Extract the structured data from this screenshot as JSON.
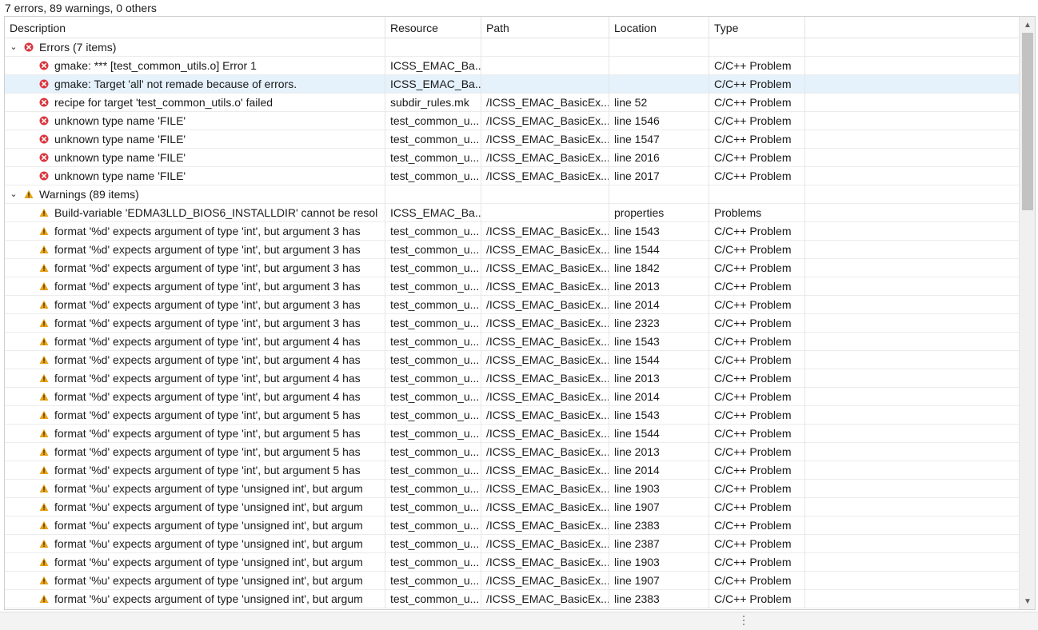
{
  "summary": "7 errors, 89 warnings, 0 others",
  "columns": {
    "description": "Description",
    "resource": "Resource",
    "path": "Path",
    "location": "Location",
    "type": "Type"
  },
  "icons": {
    "error": "error-icon",
    "warning": "warning-icon",
    "expanded": "chevron-down-icon",
    "sort": "sort-up-arrow-icon"
  },
  "colors": {
    "error": "#d9363e",
    "warning": "#e8a317",
    "selection": "#e5f1fb"
  },
  "groups": {
    "errors": {
      "label": "Errors (7 items)"
    },
    "warnings": {
      "label": "Warnings (89 items)"
    }
  },
  "errors": [
    {
      "description": "gmake: *** [test_common_utils.o] Error 1",
      "resource": "ICSS_EMAC_Ba...",
      "path": "",
      "location": "",
      "type": "C/C++ Problem"
    },
    {
      "description": "gmake: Target 'all' not remade because of errors.",
      "resource": "ICSS_EMAC_Ba...",
      "path": "",
      "location": "",
      "type": "C/C++ Problem"
    },
    {
      "description": "recipe for target 'test_common_utils.o' failed",
      "resource": "subdir_rules.mk",
      "path": "/ICSS_EMAC_BasicEx...",
      "location": "line 52",
      "type": "C/C++ Problem"
    },
    {
      "description": "unknown type name 'FILE'",
      "resource": "test_common_u...",
      "path": "/ICSS_EMAC_BasicEx...",
      "location": "line 1546",
      "type": "C/C++ Problem"
    },
    {
      "description": "unknown type name 'FILE'",
      "resource": "test_common_u...",
      "path": "/ICSS_EMAC_BasicEx...",
      "location": "line 1547",
      "type": "C/C++ Problem"
    },
    {
      "description": "unknown type name 'FILE'",
      "resource": "test_common_u...",
      "path": "/ICSS_EMAC_BasicEx...",
      "location": "line 2016",
      "type": "C/C++ Problem"
    },
    {
      "description": "unknown type name 'FILE'",
      "resource": "test_common_u...",
      "path": "/ICSS_EMAC_BasicEx...",
      "location": "line 2017",
      "type": "C/C++ Problem"
    }
  ],
  "warnings": [
    {
      "description": "Build-variable 'EDMA3LLD_BIOS6_INSTALLDIR' cannot be resol",
      "resource": "ICSS_EMAC_Ba...",
      "path": "",
      "location": "properties",
      "type": "Problems"
    },
    {
      "description": "format '%d' expects argument of type 'int', but argument 3 has",
      "resource": "test_common_u...",
      "path": "/ICSS_EMAC_BasicEx...",
      "location": "line 1543",
      "type": "C/C++ Problem"
    },
    {
      "description": "format '%d' expects argument of type 'int', but argument 3 has",
      "resource": "test_common_u...",
      "path": "/ICSS_EMAC_BasicEx...",
      "location": "line 1544",
      "type": "C/C++ Problem"
    },
    {
      "description": "format '%d' expects argument of type 'int', but argument 3 has",
      "resource": "test_common_u...",
      "path": "/ICSS_EMAC_BasicEx...",
      "location": "line 1842",
      "type": "C/C++ Problem"
    },
    {
      "description": "format '%d' expects argument of type 'int', but argument 3 has",
      "resource": "test_common_u...",
      "path": "/ICSS_EMAC_BasicEx...",
      "location": "line 2013",
      "type": "C/C++ Problem"
    },
    {
      "description": "format '%d' expects argument of type 'int', but argument 3 has",
      "resource": "test_common_u...",
      "path": "/ICSS_EMAC_BasicEx...",
      "location": "line 2014",
      "type": "C/C++ Problem"
    },
    {
      "description": "format '%d' expects argument of type 'int', but argument 3 has",
      "resource": "test_common_u...",
      "path": "/ICSS_EMAC_BasicEx...",
      "location": "line 2323",
      "type": "C/C++ Problem"
    },
    {
      "description": "format '%d' expects argument of type 'int', but argument 4 has",
      "resource": "test_common_u...",
      "path": "/ICSS_EMAC_BasicEx...",
      "location": "line 1543",
      "type": "C/C++ Problem"
    },
    {
      "description": "format '%d' expects argument of type 'int', but argument 4 has",
      "resource": "test_common_u...",
      "path": "/ICSS_EMAC_BasicEx...",
      "location": "line 1544",
      "type": "C/C++ Problem"
    },
    {
      "description": "format '%d' expects argument of type 'int', but argument 4 has",
      "resource": "test_common_u...",
      "path": "/ICSS_EMAC_BasicEx...",
      "location": "line 2013",
      "type": "C/C++ Problem"
    },
    {
      "description": "format '%d' expects argument of type 'int', but argument 4 has",
      "resource": "test_common_u...",
      "path": "/ICSS_EMAC_BasicEx...",
      "location": "line 2014",
      "type": "C/C++ Problem"
    },
    {
      "description": "format '%d' expects argument of type 'int', but argument 5 has",
      "resource": "test_common_u...",
      "path": "/ICSS_EMAC_BasicEx...",
      "location": "line 1543",
      "type": "C/C++ Problem"
    },
    {
      "description": "format '%d' expects argument of type 'int', but argument 5 has",
      "resource": "test_common_u...",
      "path": "/ICSS_EMAC_BasicEx...",
      "location": "line 1544",
      "type": "C/C++ Problem"
    },
    {
      "description": "format '%d' expects argument of type 'int', but argument 5 has",
      "resource": "test_common_u...",
      "path": "/ICSS_EMAC_BasicEx...",
      "location": "line 2013",
      "type": "C/C++ Problem"
    },
    {
      "description": "format '%d' expects argument of type 'int', but argument 5 has",
      "resource": "test_common_u...",
      "path": "/ICSS_EMAC_BasicEx...",
      "location": "line 2014",
      "type": "C/C++ Problem"
    },
    {
      "description": "format '%u' expects argument of type 'unsigned int', but argum",
      "resource": "test_common_u...",
      "path": "/ICSS_EMAC_BasicEx...",
      "location": "line 1903",
      "type": "C/C++ Problem"
    },
    {
      "description": "format '%u' expects argument of type 'unsigned int', but argum",
      "resource": "test_common_u...",
      "path": "/ICSS_EMAC_BasicEx...",
      "location": "line 1907",
      "type": "C/C++ Problem"
    },
    {
      "description": "format '%u' expects argument of type 'unsigned int', but argum",
      "resource": "test_common_u...",
      "path": "/ICSS_EMAC_BasicEx...",
      "location": "line 2383",
      "type": "C/C++ Problem"
    },
    {
      "description": "format '%u' expects argument of type 'unsigned int', but argum",
      "resource": "test_common_u...",
      "path": "/ICSS_EMAC_BasicEx...",
      "location": "line 2387",
      "type": "C/C++ Problem"
    },
    {
      "description": "format '%u' expects argument of type 'unsigned int', but argum",
      "resource": "test_common_u...",
      "path": "/ICSS_EMAC_BasicEx...",
      "location": "line 1903",
      "type": "C/C++ Problem"
    },
    {
      "description": "format '%u' expects argument of type 'unsigned int', but argum",
      "resource": "test_common_u...",
      "path": "/ICSS_EMAC_BasicEx...",
      "location": "line 1907",
      "type": "C/C++ Problem"
    },
    {
      "description": "format '%u' expects argument of type 'unsigned int', but argum",
      "resource": "test_common_u...",
      "path": "/ICSS_EMAC_BasicEx...",
      "location": "line 2383",
      "type": "C/C++ Problem"
    }
  ]
}
